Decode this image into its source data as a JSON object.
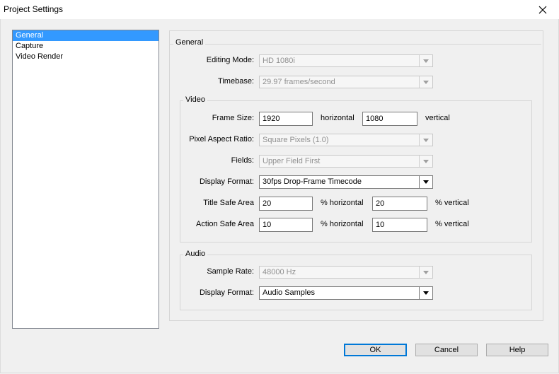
{
  "window": {
    "title": "Project Settings"
  },
  "nav": {
    "items": [
      {
        "label": "General"
      },
      {
        "label": "Capture"
      },
      {
        "label": "Video Render"
      }
    ]
  },
  "general": {
    "title": "General",
    "editing_mode": {
      "label": "Editing Mode:",
      "value": "HD 1080i"
    },
    "timebase": {
      "label": "Timebase:",
      "value": "29.97 frames/second"
    }
  },
  "video": {
    "title": "Video",
    "frame_size": {
      "label": "Frame Size:",
      "width": "1920",
      "width_unit": "horizontal",
      "height": "1080",
      "height_unit": "vertical"
    },
    "pixel_aspect": {
      "label": "Pixel Aspect Ratio:",
      "value": "Square Pixels (1.0)"
    },
    "fields": {
      "label": "Fields:",
      "value": "Upper Field First"
    },
    "display_format": {
      "label": "Display Format:",
      "value": "30fps Drop-Frame Timecode"
    },
    "title_safe": {
      "label": "Title Safe Area",
      "h": "20",
      "h_unit": "% horizontal",
      "v": "20",
      "v_unit": "% vertical"
    },
    "action_safe": {
      "label": "Action Safe Area",
      "h": "10",
      "h_unit": "% horizontal",
      "v": "10",
      "v_unit": "% vertical"
    }
  },
  "audio": {
    "title": "Audio",
    "sample_rate": {
      "label": "Sample Rate:",
      "value": "48000 Hz"
    },
    "display_format": {
      "label": "Display Format:",
      "value": "Audio Samples"
    }
  },
  "buttons": {
    "ok": "OK",
    "cancel": "Cancel",
    "help": "Help"
  },
  "icons": {
    "close": "close-icon",
    "dropdown": "chevron-down-icon"
  },
  "colors": {
    "selection": "#3399ff",
    "default_button_border": "#0078d7"
  }
}
